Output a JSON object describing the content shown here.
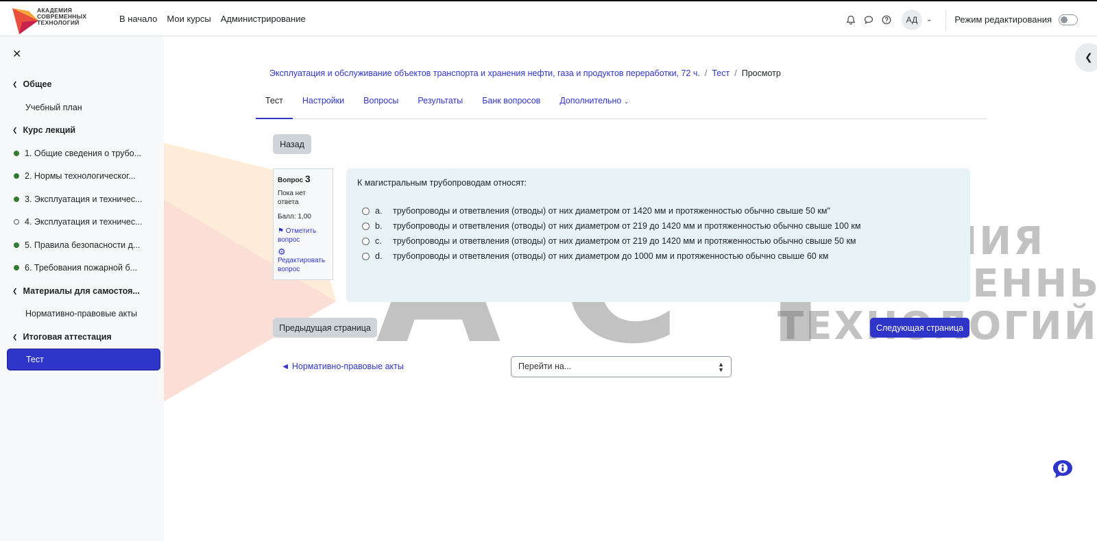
{
  "brand": {
    "line1": "АКАДЕМИЯ",
    "line2": "СОВРЕМЕННЫХ",
    "line3": "ТЕХНОЛОГИЙ"
  },
  "nav": {
    "home": "В начало",
    "my_courses": "Мои курсы",
    "admin": "Администрирование"
  },
  "user": {
    "initials": "АД",
    "edit_mode_label": "Режим редактирования"
  },
  "sidebar": {
    "items": [
      {
        "label": "Общее"
      },
      {
        "label": "Учебный план"
      },
      {
        "label": "Курс лекций"
      },
      {
        "label": "1. Общие сведения о трубо..."
      },
      {
        "label": "2. Нормы технологическог..."
      },
      {
        "label": "3. Эксплуатация и техничес..."
      },
      {
        "label": "4. Эксплуатация и техничес..."
      },
      {
        "label": "5. Правила безопасности д..."
      },
      {
        "label": "6. Требования пожарной б..."
      },
      {
        "label": "Материалы для самостоя..."
      },
      {
        "label": "Нормативно-правовые акты"
      },
      {
        "label": "Итоговая аттестация"
      },
      {
        "label": "Тест"
      }
    ]
  },
  "breadcrumb": {
    "course": "Эксплуатация и обслуживание объектов транспорта и хранения нефти, газа и продуктов переработки, 72 ч.",
    "sep": "/",
    "quiz": "Тест",
    "current": "Просмотр"
  },
  "tabs": [
    "Тест",
    "Настройки",
    "Вопросы",
    "Результаты",
    "Банк вопросов",
    "Дополнительно"
  ],
  "back_button": "Назад",
  "question_info": {
    "label": "Вопрос",
    "number": "3",
    "state": "Пока нет ответа",
    "mark": "Балл: 1,00",
    "flag": "Отметить вопрос",
    "edit": "Редактировать вопрос"
  },
  "question": {
    "text": "К магистральным трубопроводам относят:",
    "options": [
      {
        "letter": "a.",
        "text": "трубопроводы и ответвления (отводы) от них диаметром от 1420 мм и протяженностью обычно свыше 50 км\""
      },
      {
        "letter": "b.",
        "text": "трубопроводы и ответвления (отводы) от них диаметром от 219 до 1420 мм и протяженностью обычно свыше 100 км"
      },
      {
        "letter": "c.",
        "text": "трубопроводы и ответвления (отводы) от них диаметром от 219 до 1420 мм и протяженностью обычно свыше 50 км"
      },
      {
        "letter": "d.",
        "text": "трубопроводы и ответвления (отводы) от них диаметром до 1000 мм и протяженностью обычно свыше 60 км"
      }
    ]
  },
  "nav_buttons": {
    "prev": "Предыдущая страница",
    "next": "Следующая страница"
  },
  "prev_activity": "Нормативно-правовые акты",
  "jump_select": "Перейти на...",
  "watermark": {
    "big": "АСТ",
    "line1": "АКАДЕМИЯ",
    "line2": "СОВРЕМЕННЫХ",
    "line3": "ТЕХНОЛОГИЙ"
  },
  "colors": {
    "primary": "#2f35c9",
    "done": "#357a32",
    "question_bg": "#e7f3f5"
  }
}
